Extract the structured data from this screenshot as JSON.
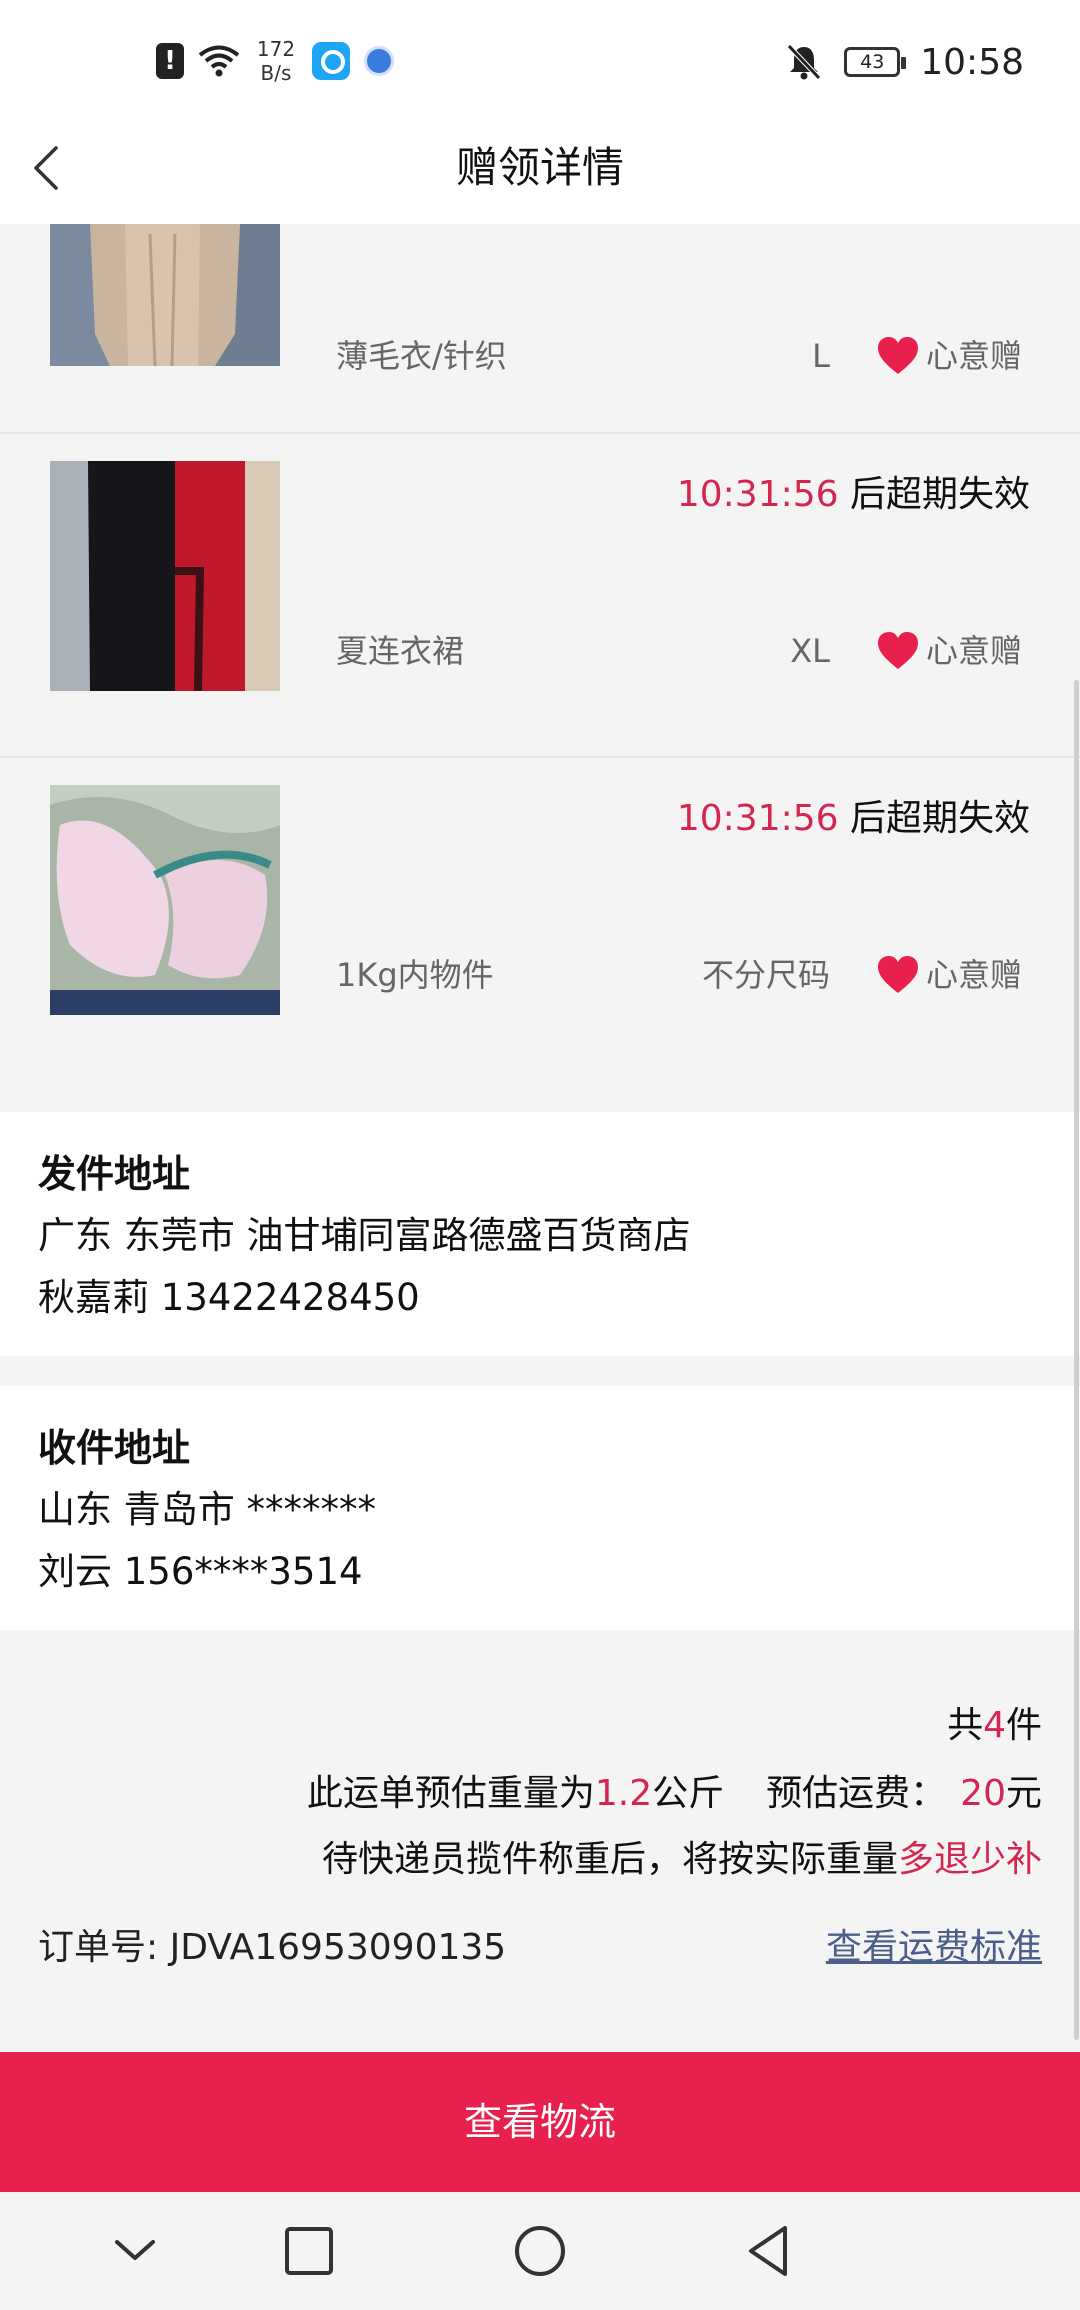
{
  "status_bar": {
    "speed_top": "172",
    "speed_bottom": "B/s",
    "battery": "43",
    "time": "10:58"
  },
  "header": {
    "title": "赠领详情",
    "back_icon": "chevron-left-icon"
  },
  "items": [
    {
      "category": "薄毛衣/针织",
      "size": "L",
      "gift_label": "心意赠",
      "image": "beige-knit-sweater"
    },
    {
      "countdown_time": "10:31:56",
      "countdown_suffix": " 后超期失效",
      "category": "夏连衣裙",
      "size": "XL",
      "gift_label": "心意赠",
      "image": "red-black-dress"
    },
    {
      "countdown_time": "10:31:56",
      "countdown_suffix": " 后超期失效",
      "category": "1Kg内物件",
      "size": "不分尺码",
      "gift_label": "心意赠",
      "image": "pink-bra"
    }
  ],
  "sender": {
    "title": "发件地址",
    "address": "广东 东莞市 油甘埔同富路德盛百货商店",
    "contact": "秋嘉莉 13422428450"
  },
  "receiver": {
    "title": "收件地址",
    "address": "山东 青岛市 *******",
    "contact": "刘云 156****3514"
  },
  "summary": {
    "total_prefix": "共",
    "total_count": "4",
    "total_suffix": "件",
    "weight_prefix": "此运单预估重量为",
    "weight_value": "1.2",
    "weight_unit": "公斤",
    "fee_prefix": "预估运费：",
    "fee_value": "20",
    "fee_unit": "元",
    "note_prefix": "待快递员揽件称重后，将按实际重量",
    "note_highlight": "多退少补",
    "order_label": "订单号:",
    "order_number": "JDVA16953090135",
    "fee_standard_link": "查看运费标准"
  },
  "action": {
    "logistics_button": "查看物流"
  },
  "colors": {
    "accent": "#e8204d",
    "highlight_text": "#d4264f",
    "link": "#4b5f8a"
  }
}
